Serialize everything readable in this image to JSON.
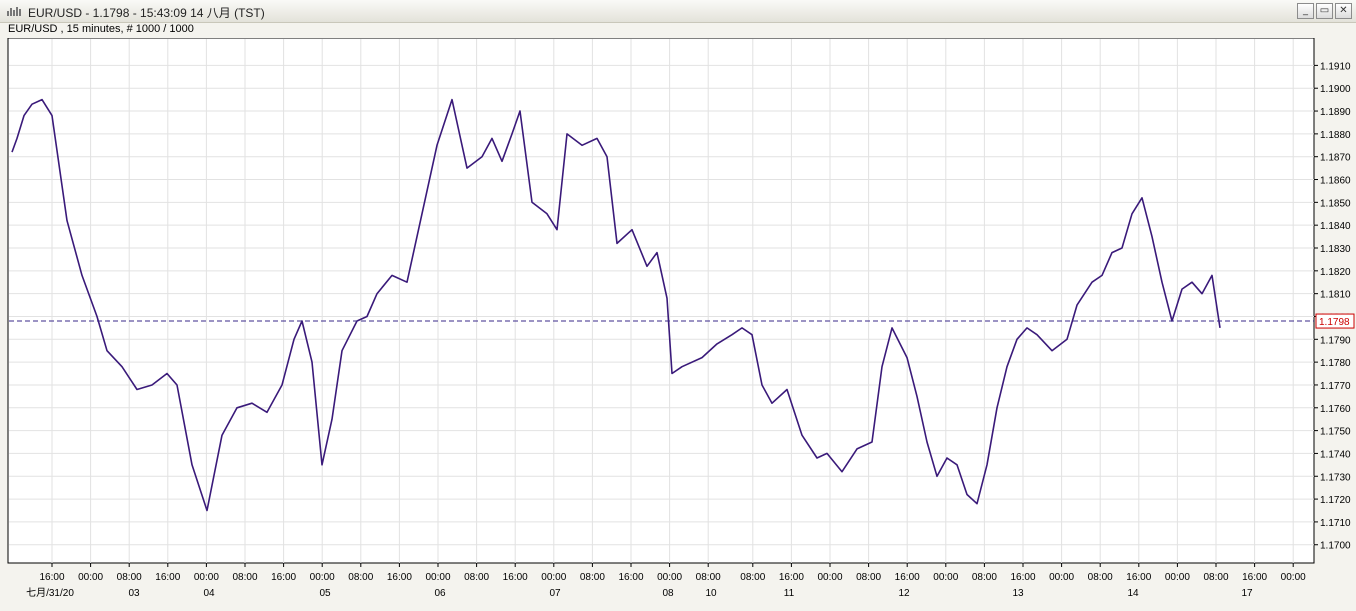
{
  "window": {
    "title": "EUR/USD - 1.1798 - 15:43:09  14 八月 (TST)",
    "buttons": [
      "_",
      "▭",
      "✕"
    ]
  },
  "chart_header": "EUR/USD , 15 minutes, # 1000 / 1000",
  "colors": {
    "candle": "#3a1a7a",
    "current_line": "#3a2a8a",
    "current_label": "#cc0000",
    "grid": "#e2e2e2",
    "background": "#ffffff"
  },
  "chart_data": {
    "type": "line",
    "symbol": "EUR/USD",
    "interval": "15 minutes",
    "ylim": [
      1.1692,
      1.1922
    ],
    "y_ticks": [
      "1.1700",
      "1.1710",
      "1.1720",
      "1.1730",
      "1.1740",
      "1.1750",
      "1.1760",
      "1.1770",
      "1.1780",
      "1.1790",
      "1.1800",
      "1.1810",
      "1.1820",
      "1.1830",
      "1.1840",
      "1.1850",
      "1.1860",
      "1.1870",
      "1.1880",
      "1.1890",
      "1.1900",
      "1.1910"
    ],
    "x_ticks": [
      "16:00",
      "00:00",
      "08:00",
      "16:00",
      "00:00",
      "08:00",
      "16:00",
      "00:00",
      "08:00",
      "16:00",
      "00:00",
      "08:00",
      "16:00",
      "00:00",
      "08:00",
      "16:00",
      "00:00",
      "08:00",
      "08:00",
      "16:00",
      "00:00",
      "08:00",
      "16:00",
      "00:00",
      "08:00",
      "16:00",
      "00:00",
      "08:00",
      "16:00",
      "00:00",
      "08:00",
      "16:00",
      "00:00",
      "08:00"
    ],
    "date_labels": [
      "七月/31/20",
      "03",
      "04",
      "05",
      "06",
      "07",
      "08",
      "10",
      "11",
      "12",
      "13",
      "14",
      "17"
    ],
    "current_price": 1.1798,
    "current_price_label": "1.1798",
    "series": [
      {
        "x": [
          0,
          5,
          12,
          20,
          30,
          40,
          55,
          70,
          85,
          95,
          110,
          125,
          140,
          155,
          165,
          180,
          195,
          210,
          225,
          240,
          255,
          270,
          282,
          290,
          300,
          310,
          320,
          330,
          345,
          355,
          365,
          380,
          395,
          405,
          415,
          425,
          440,
          455,
          470,
          480,
          490,
          500,
          508,
          520,
          535,
          545,
          555,
          570,
          585,
          595,
          605,
          620,
          635,
          645,
          655,
          660,
          670,
          690,
          705,
          720,
          730,
          740,
          750,
          760,
          775,
          790,
          805,
          815,
          830,
          845,
          860,
          870,
          880,
          895,
          905,
          915,
          925,
          935,
          945,
          955,
          965,
          975,
          985,
          995,
          1005,
          1015,
          1025,
          1040,
          1055,
          1065,
          1080,
          1090,
          1100,
          1110,
          1120,
          1130,
          1140,
          1150,
          1160,
          1170,
          1180,
          1190,
          1200,
          1208
        ],
        "y": [
          1.1872,
          1.1878,
          1.1888,
          1.1893,
          1.1895,
          1.1888,
          1.1842,
          1.1818,
          1.18,
          1.1785,
          1.1778,
          1.1768,
          1.177,
          1.1775,
          1.177,
          1.1735,
          1.1715,
          1.1748,
          1.176,
          1.1762,
          1.1758,
          1.177,
          1.179,
          1.1798,
          1.178,
          1.1735,
          1.1755,
          1.1785,
          1.1798,
          1.18,
          1.181,
          1.1818,
          1.1815,
          1.1835,
          1.1855,
          1.1875,
          1.1895,
          1.1865,
          1.187,
          1.1878,
          1.1868,
          1.188,
          1.189,
          1.185,
          1.1845,
          1.1838,
          1.188,
          1.1875,
          1.1878,
          1.187,
          1.1832,
          1.1838,
          1.1822,
          1.1828,
          1.1808,
          1.1775,
          1.1778,
          1.1782,
          1.1788,
          1.1792,
          1.1795,
          1.1792,
          1.177,
          1.1762,
          1.1768,
          1.1748,
          1.1738,
          1.174,
          1.1732,
          1.1742,
          1.1745,
          1.1778,
          1.1795,
          1.1782,
          1.1765,
          1.1745,
          1.173,
          1.1738,
          1.1735,
          1.1722,
          1.1718,
          1.1735,
          1.176,
          1.1778,
          1.179,
          1.1795,
          1.1792,
          1.1785,
          1.179,
          1.1805,
          1.1815,
          1.1818,
          1.1828,
          1.183,
          1.1845,
          1.1852,
          1.1835,
          1.1815,
          1.1798,
          1.1812,
          1.1815,
          1.181,
          1.1818,
          1.1795
        ]
      }
    ]
  }
}
